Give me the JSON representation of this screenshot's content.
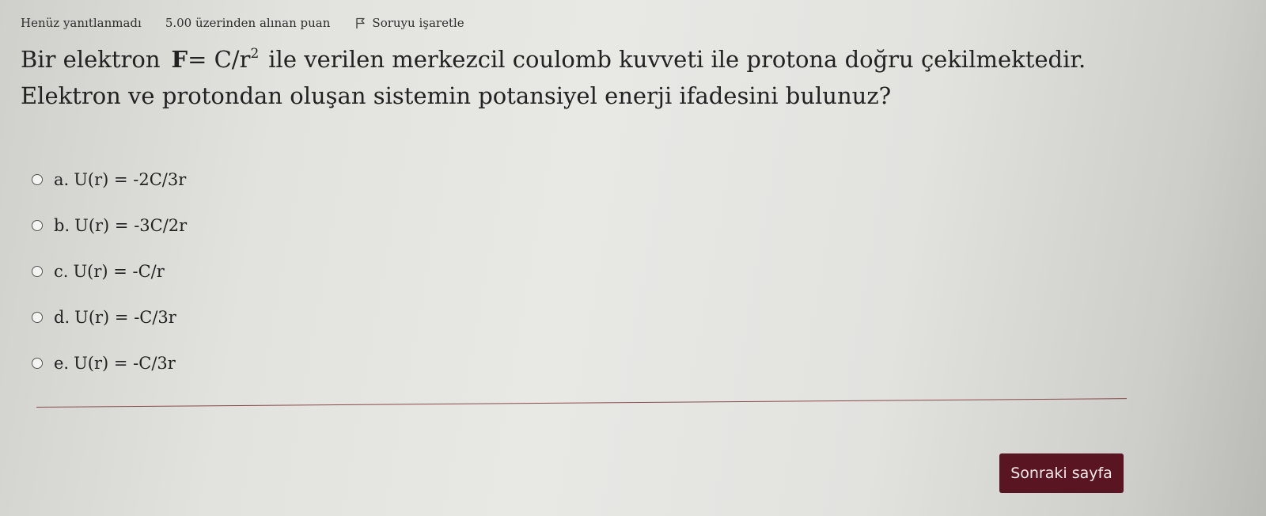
{
  "question_info": {
    "status": "Henüz yanıtlanmadı",
    "grade": "5.00 üzerinden alınan puan",
    "flag_label": "Soruyu işaretle"
  },
  "question": {
    "line1_before": "Bir elektron",
    "formula_bold": "F",
    "formula_rest": "= C/r",
    "formula_exponent": "2",
    "line1_after": "ile verilen merkezcil coulomb kuvveti ile protona doğru çekilmektedir.",
    "line2": "Elektron ve protondan oluşan sistemin potansiyel enerji ifadesini bulunuz?"
  },
  "answers": [
    {
      "letter": "a.",
      "text": "U(r) = -2C/3r"
    },
    {
      "letter": "b.",
      "text": "U(r) = -3C/2r"
    },
    {
      "letter": "c.",
      "text": "U(r) = -C/r"
    },
    {
      "letter": "d.",
      "text": "U(r) = -C/3r"
    },
    {
      "letter": "e.",
      "text": "U(r) = -C/3r"
    }
  ],
  "navigation": {
    "next_label": "Sonraki sayfa"
  },
  "colors": {
    "button_bg": "#5a1522",
    "divider": "#8a4b4b"
  },
  "icons": {
    "flag": "flag-icon",
    "radio": "radio-button"
  }
}
